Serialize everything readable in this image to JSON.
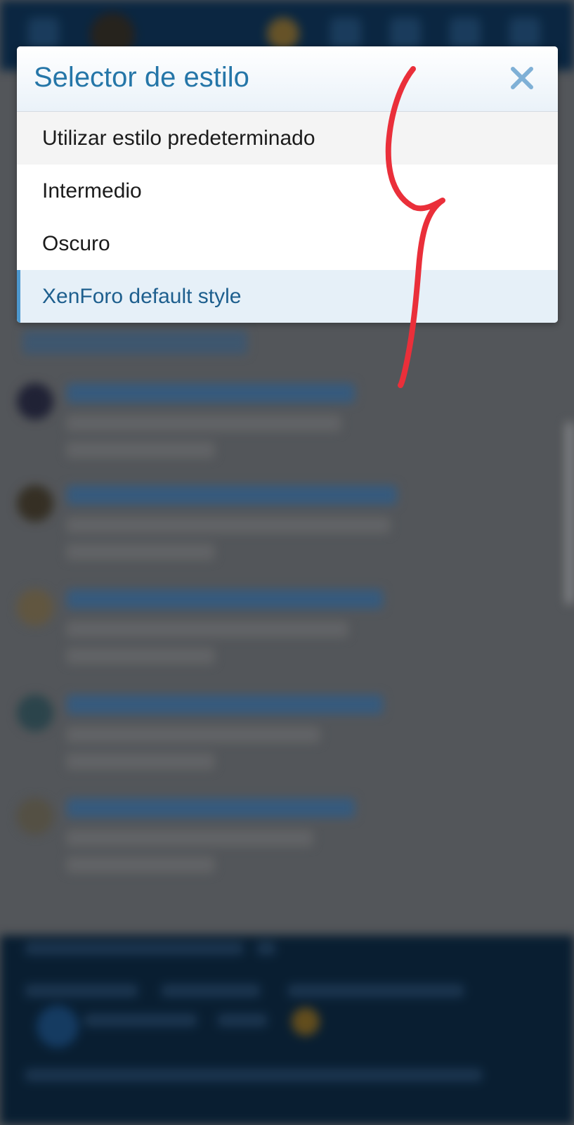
{
  "modal": {
    "title": "Selector de estilo",
    "close_icon": "close-icon",
    "items": [
      {
        "label": "Utilizar estilo predeterminado",
        "state": "hover"
      },
      {
        "label": "Intermedio",
        "state": "normal"
      },
      {
        "label": "Oscuro",
        "state": "normal"
      },
      {
        "label": "XenForo default style",
        "state": "selected"
      }
    ]
  },
  "colors": {
    "title": "#2576a8",
    "selected_bg": "#e6f0f8",
    "selected_accent": "#4d98cf",
    "annotation": "#ea2f3a",
    "header_bar": "#0c2a47"
  }
}
